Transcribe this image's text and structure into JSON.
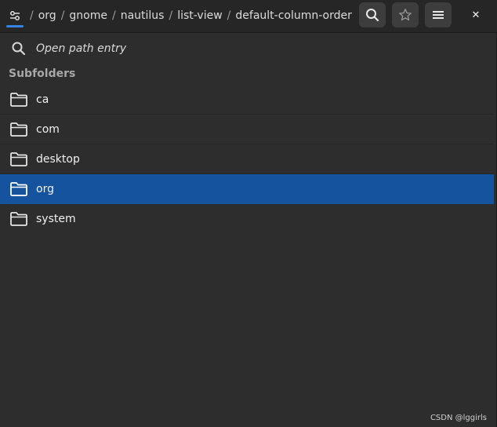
{
  "header": {
    "path": [
      "org",
      "gnome",
      "nautilus",
      "list-view",
      "default-column-order"
    ],
    "separator": "/",
    "buttons": {
      "search_icon": "search-icon",
      "bookmark_icon": "star-icon",
      "menu_icon": "hamburger-menu-icon",
      "close_icon": "close-icon",
      "close_glyph": "✕"
    }
  },
  "search": {
    "placeholder": "Open path entry"
  },
  "subfolders": {
    "title": "Subfolders",
    "items": [
      {
        "label": "ca",
        "selected": false
      },
      {
        "label": "com",
        "selected": false
      },
      {
        "label": "desktop",
        "selected": false
      },
      {
        "label": "org",
        "selected": true
      },
      {
        "label": "system",
        "selected": false
      }
    ]
  },
  "watermark": "CSDN @lggirls",
  "colors": {
    "accent": "#3584e4",
    "selection": "#15539e",
    "background": "#2d2d2d",
    "headerbar": "#262626"
  }
}
